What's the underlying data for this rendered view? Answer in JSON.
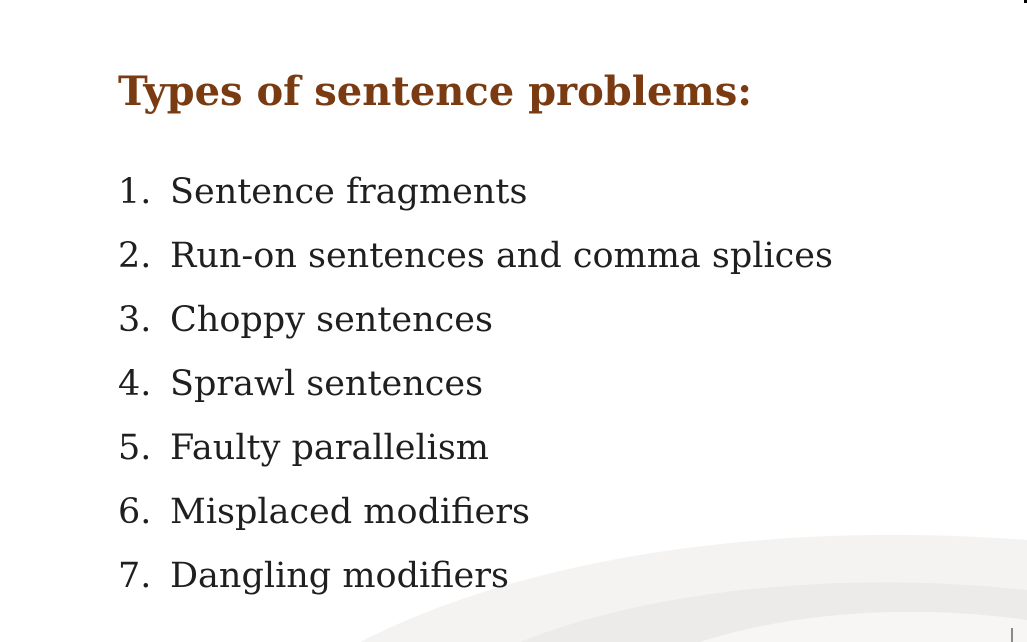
{
  "slide": {
    "title": "Types of sentence problems:",
    "items": [
      {
        "number": "1.",
        "text": "Sentence fragments"
      },
      {
        "number": "2.",
        "text": "Run-on sentences and comma splices"
      },
      {
        "number": "3.",
        "text": "Choppy sentences"
      },
      {
        "number": "4.",
        "text": "Sprawl sentences"
      },
      {
        "number": "5.",
        "text": "Faulty parallelism"
      },
      {
        "number": "6.",
        "text": "Misplaced modifiers"
      },
      {
        "number": "7.",
        "text": "Dangling modifiers"
      }
    ]
  },
  "colors": {
    "title": "#7a3b12",
    "body_text": "#1f1f1f",
    "background": "#ffffff"
  }
}
